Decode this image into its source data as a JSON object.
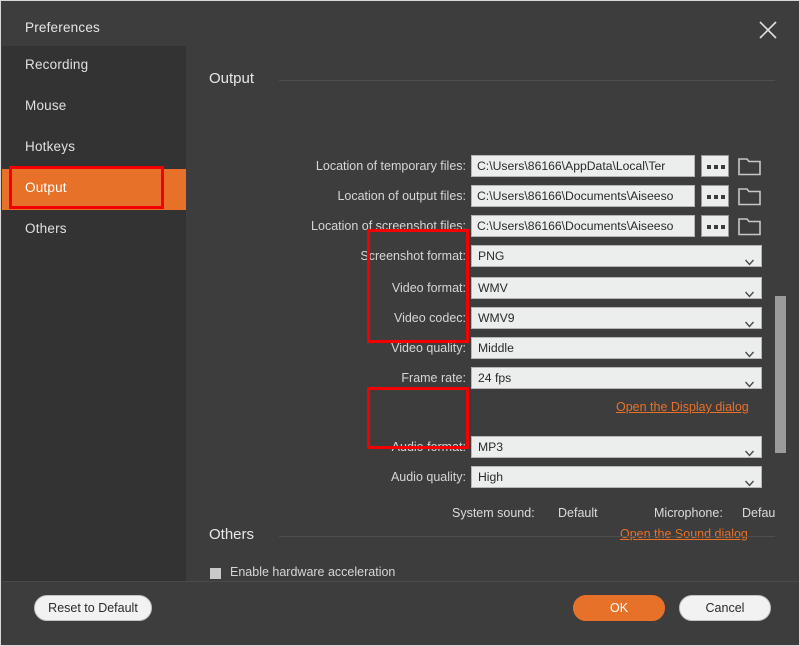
{
  "window": {
    "title": "Preferences",
    "close_icon": "close-icon"
  },
  "sidebar": {
    "items": [
      {
        "label": "Recording",
        "active": false
      },
      {
        "label": "Mouse",
        "active": false
      },
      {
        "label": "Hotkeys",
        "active": false
      },
      {
        "label": "Output",
        "active": true
      },
      {
        "label": "Others",
        "active": false
      }
    ]
  },
  "output_section": {
    "heading": "Output",
    "paths": [
      {
        "label": "Location of temporary files:",
        "value": "C:\\Users\\86166\\AppData\\Local\\Ter",
        "browse_label": "browse-dots-button",
        "folder_label": "folder-icon"
      },
      {
        "label": "Location of output files:",
        "value": "C:\\Users\\86166\\Documents\\Aiseeso",
        "browse_label": "browse-dots-button",
        "folder_label": "folder-icon"
      },
      {
        "label": "Location of screenshot files:",
        "value": "C:\\Users\\86166\\Documents\\Aiseeso",
        "browse_label": "browse-dots-button",
        "folder_label": "folder-icon"
      }
    ],
    "screenshot_format": {
      "label": "Screenshot format:",
      "value": "PNG"
    },
    "video": [
      {
        "label": "Video format:",
        "value": "WMV"
      },
      {
        "label": "Video codec:",
        "value": "WMV9"
      },
      {
        "label": "Video quality:",
        "value": "Middle"
      },
      {
        "label": "Frame rate:",
        "value": "24 fps"
      }
    ],
    "display_dialog_link": "Open the Display dialog",
    "audio": [
      {
        "label": "Audio format:",
        "value": "MP3"
      },
      {
        "label": "Audio quality:",
        "value": "High"
      }
    ],
    "system_sound": {
      "label": "System sound:",
      "value": "Default"
    },
    "microphone": {
      "label": "Microphone:",
      "value": "Default"
    },
    "sound_dialog_link": "Open the Sound dialog"
  },
  "others_section": {
    "heading": "Others",
    "hardware_accel": {
      "label": "Enable hardware acceleration",
      "checked": false
    }
  },
  "footer": {
    "reset_label": "Reset to Default",
    "ok_label": "OK",
    "cancel_label": "Cancel"
  },
  "colors": {
    "accent": "#e8712a",
    "annotation": "#f50000",
    "window_bg": "#3d3d3d",
    "sidebar_bg": "#333333"
  }
}
